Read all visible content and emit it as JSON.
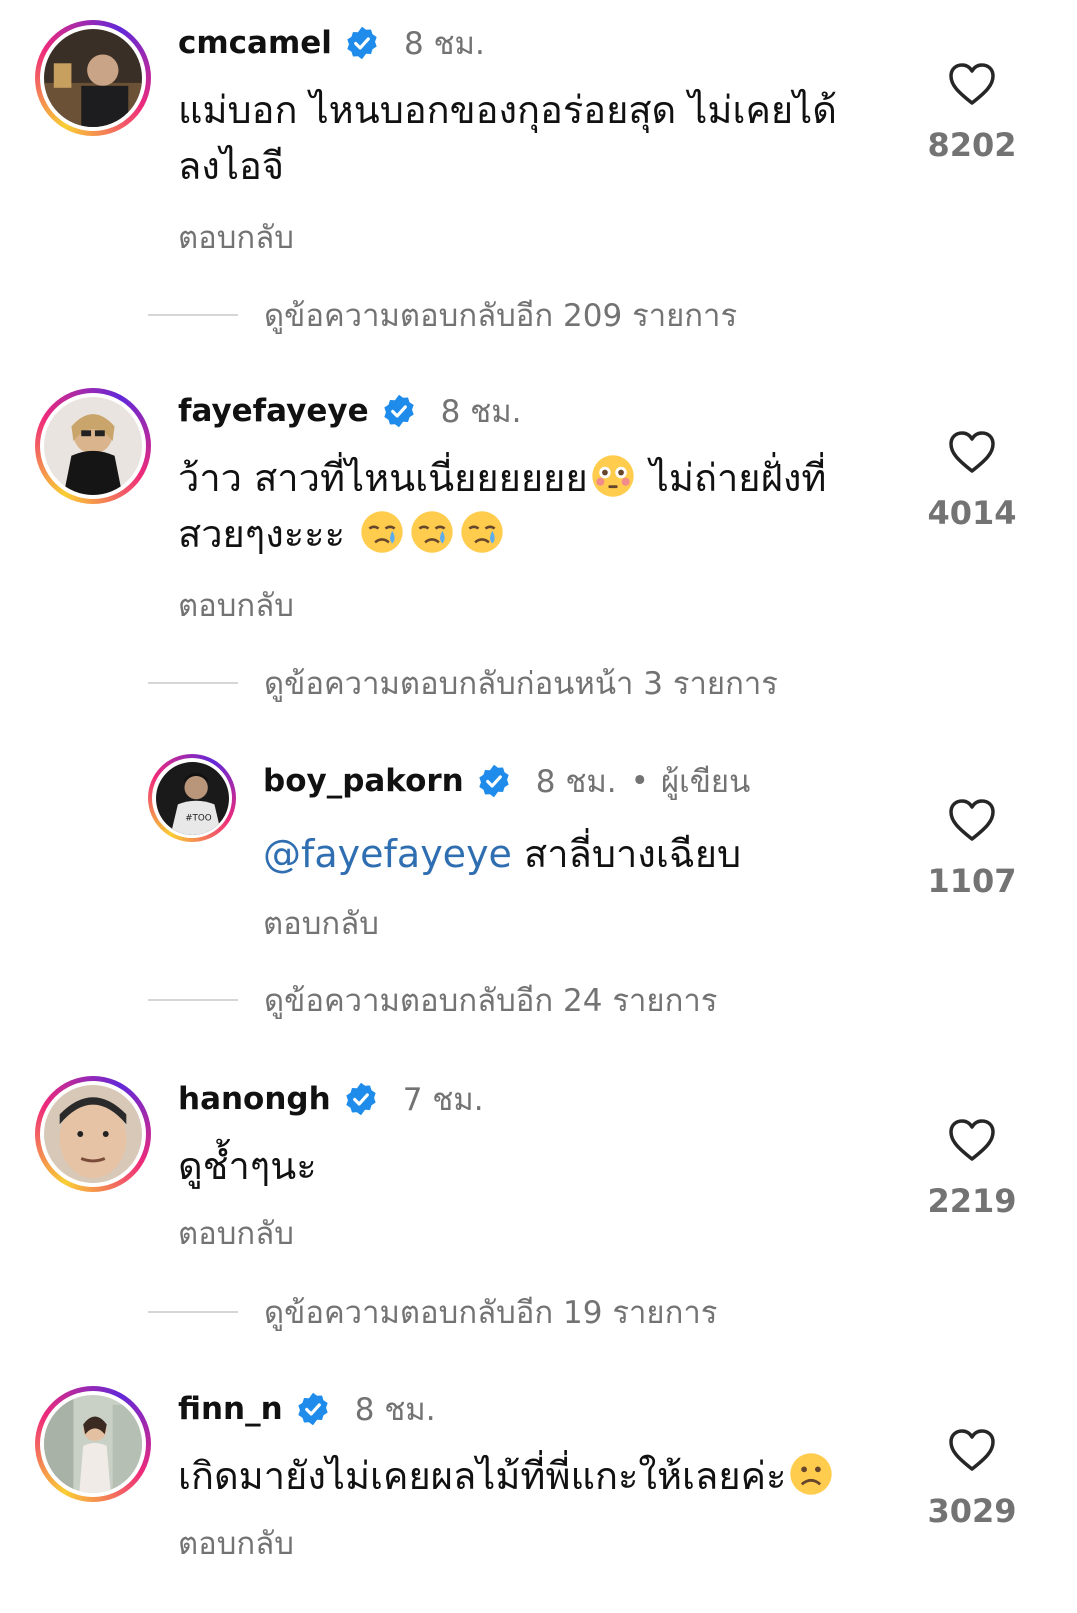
{
  "comments": [
    {
      "username": "cmcamel",
      "time": "8 ชม.",
      "text_line1": "แม่บอก ไหนบอกของกุอร่อยสุด ไม่เคยได้",
      "text_line2": "ลงไอจี",
      "reply_label": "ตอบกลับ",
      "likes": "8202",
      "more_replies": "ดูข้อความตอบกลับอีก 209 รายการ"
    },
    {
      "username": "fayefayeye",
      "time": "8 ชม.",
      "text_line1": "ว้าว สาวที่ไหนเนี่ยยยยยย",
      "text_line1b": " ไม่ถ่ายฝั่งที่",
      "text_line2": "สวยๆงะะะ ",
      "reply_label": "ตอบกลับ",
      "likes": "4014",
      "more_replies": "ดูข้อความตอบกลับก่อนหน้า 3 รายการ"
    },
    {
      "username": "boy_pakorn",
      "time": "8 ชม.",
      "author_dot": "•",
      "author_label": "ผู้เขียน",
      "mention": "@fayefayeye",
      "text": " สาลี่บางเฉียบ",
      "reply_label": "ตอบกลับ",
      "likes": "1107",
      "more_replies": "ดูข้อความตอบกลับอีก 24 รายการ"
    },
    {
      "username": "hanongh",
      "time": "7 ชม.",
      "text": "ดูช้ำๆนะ",
      "reply_label": "ตอบกลับ",
      "likes": "2219",
      "more_replies": "ดูข้อความตอบกลับอีก 19 รายการ"
    },
    {
      "username": "finn_n",
      "time": "8 ชม.",
      "text": "เกิดมายังไม่เคยผลไม้ที่พี่แกะให้เลยค่ะ",
      "reply_label": "ตอบกลับ",
      "likes": "3029"
    }
  ],
  "colors": {
    "text_primary": "#111111",
    "text_secondary": "#737373",
    "mention": "#2f6fb1",
    "verified_badge": "#1f8ceb",
    "divider": "#d6d6d6"
  },
  "icons": {
    "verified": "verified-badge-icon",
    "like": "heart-outline-icon",
    "emoji_flushed": "flushed-face-emoji",
    "emoji_crying": "crying-face-emoji",
    "emoji_frowning": "frowning-face-emoji"
  }
}
